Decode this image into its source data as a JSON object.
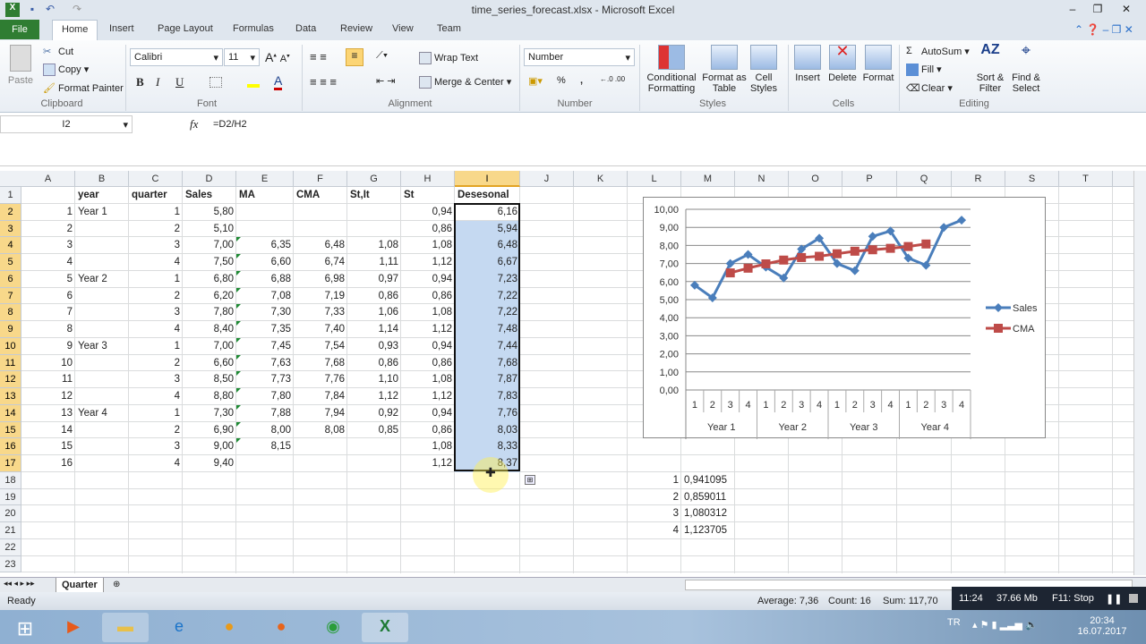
{
  "window": {
    "title": "time_series_forecast.xlsx  -  Microsoft Excel"
  },
  "ribbon": {
    "tabs": [
      "File",
      "Home",
      "Insert",
      "Page Layout",
      "Formulas",
      "Data",
      "Review",
      "View",
      "Team"
    ],
    "clipboard": {
      "paste": "Paste",
      "cut": "Cut",
      "copy": "Copy",
      "format_painter": "Format Painter",
      "label": "Clipboard"
    },
    "font": {
      "name": "Calibri",
      "size": "11",
      "bold": "B",
      "italic": "I",
      "underline": "U",
      "label": "Font"
    },
    "alignment": {
      "wrap": "Wrap Text",
      "merge": "Merge & Center",
      "label": "Alignment"
    },
    "number": {
      "format": "Number",
      "percent": "%",
      "comma": ",",
      "label": "Number"
    },
    "styles": {
      "conditional": "Conditional Formatting",
      "table": "Format as Table",
      "cell": "Cell Styles",
      "label": "Styles"
    },
    "cells": {
      "insert": "Insert",
      "delete": "Delete",
      "format": "Format",
      "label": "Cells"
    },
    "editing": {
      "autosum": "AutoSum",
      "fill": "Fill",
      "clear": "Clear",
      "sort": "Sort & Filter",
      "find": "Find & Select",
      "label": "Editing"
    }
  },
  "formula_bar": {
    "name_box": "I2",
    "fx": "fx",
    "formula": "=D2/H2"
  },
  "sheet": {
    "columns": [
      "A",
      "B",
      "C",
      "D",
      "E",
      "F",
      "G",
      "H",
      "I",
      "J",
      "K",
      "L",
      "M",
      "N",
      "O",
      "P",
      "Q",
      "R",
      "S",
      "T"
    ],
    "selected_column": "I",
    "row_numbers": [
      "1",
      "2",
      "3",
      "4",
      "5",
      "6",
      "7",
      "8",
      "9",
      "10",
      "11",
      "12",
      "13",
      "14",
      "15",
      "16",
      "17",
      "18",
      "19",
      "20",
      "21",
      "22",
      "23"
    ],
    "headers": [
      "",
      "year",
      "quarter",
      "Sales",
      "MA",
      "CMA",
      "St,It",
      "St",
      "Desesonal"
    ],
    "rows": [
      [
        "1",
        "Year 1",
        "1",
        "5,80",
        "",
        "",
        "",
        "0,94",
        "6,16"
      ],
      [
        "2",
        "",
        "2",
        "5,10",
        "",
        "",
        "",
        "0,86",
        "5,94"
      ],
      [
        "3",
        "",
        "3",
        "7,00",
        "6,35",
        "6,48",
        "1,08",
        "1,08",
        "6,48"
      ],
      [
        "4",
        "",
        "4",
        "7,50",
        "6,60",
        "6,74",
        "1,11",
        "1,12",
        "6,67"
      ],
      [
        "5",
        "Year 2",
        "1",
        "6,80",
        "6,88",
        "6,98",
        "0,97",
        "0,94",
        "7,23"
      ],
      [
        "6",
        "",
        "2",
        "6,20",
        "7,08",
        "7,19",
        "0,86",
        "0,86",
        "7,22"
      ],
      [
        "7",
        "",
        "3",
        "7,80",
        "7,30",
        "7,33",
        "1,06",
        "1,08",
        "7,22"
      ],
      [
        "8",
        "",
        "4",
        "8,40",
        "7,35",
        "7,40",
        "1,14",
        "1,12",
        "7,48"
      ],
      [
        "9",
        "Year 3",
        "1",
        "7,00",
        "7,45",
        "7,54",
        "0,93",
        "0,94",
        "7,44"
      ],
      [
        "10",
        "",
        "2",
        "6,60",
        "7,63",
        "7,68",
        "0,86",
        "0,86",
        "7,68"
      ],
      [
        "11",
        "",
        "3",
        "8,50",
        "7,73",
        "7,76",
        "1,10",
        "1,08",
        "7,87"
      ],
      [
        "12",
        "",
        "4",
        "8,80",
        "7,80",
        "7,84",
        "1,12",
        "1,12",
        "7,83"
      ],
      [
        "13",
        "Year 4",
        "1",
        "7,30",
        "7,88",
        "7,94",
        "0,92",
        "0,94",
        "7,76"
      ],
      [
        "14",
        "",
        "2",
        "6,90",
        "8,00",
        "8,08",
        "0,85",
        "0,86",
        "8,03"
      ],
      [
        "15",
        "",
        "3",
        "9,00",
        "8,15",
        "",
        "",
        "1,08",
        "8,33"
      ],
      [
        "16",
        "",
        "4",
        "9,40",
        "",
        "",
        "",
        "1,12",
        "8,37"
      ]
    ],
    "seasonal_index": [
      [
        "1",
        "0,941095"
      ],
      [
        "2",
        "0,859011"
      ],
      [
        "3",
        "1,080312"
      ],
      [
        "4",
        "1,123705"
      ]
    ],
    "sheet_tab": "Quarter"
  },
  "chart_data": {
    "type": "line",
    "categories": [
      "1",
      "2",
      "3",
      "4",
      "1",
      "2",
      "3",
      "4",
      "1",
      "2",
      "3",
      "4",
      "1",
      "2",
      "3",
      "4"
    ],
    "groups": [
      "Year 1",
      "Year 2",
      "Year 3",
      "Year 4"
    ],
    "y_ticks": [
      "0,00",
      "1,00",
      "2,00",
      "3,00",
      "4,00",
      "5,00",
      "6,00",
      "7,00",
      "8,00",
      "9,00",
      "10,00"
    ],
    "ylim": [
      0,
      10
    ],
    "grid": true,
    "legend": "right",
    "series": [
      {
        "name": "Sales",
        "color": "#4a7ebb",
        "marker": "diamond",
        "values": [
          5.8,
          5.1,
          7.0,
          7.5,
          6.8,
          6.2,
          7.8,
          8.4,
          7.0,
          6.6,
          8.5,
          8.8,
          7.3,
          6.9,
          9.0,
          9.4
        ]
      },
      {
        "name": "CMA",
        "color": "#be4b48",
        "marker": "square",
        "values": [
          null,
          null,
          6.48,
          6.74,
          6.98,
          7.19,
          7.33,
          7.4,
          7.54,
          7.68,
          7.76,
          7.84,
          7.94,
          8.08,
          null,
          null
        ]
      }
    ]
  },
  "status": {
    "ready": "Ready",
    "average": "Average: 7,36",
    "count": "Count: 16",
    "sum": "Sum: 117,70"
  },
  "recorder": {
    "time": "11:24",
    "size": "37.66 Mb",
    "stop": "F11: Stop"
  },
  "taskbar": {
    "lang": "TR",
    "time": "20:34",
    "date": "16.07.2017"
  }
}
